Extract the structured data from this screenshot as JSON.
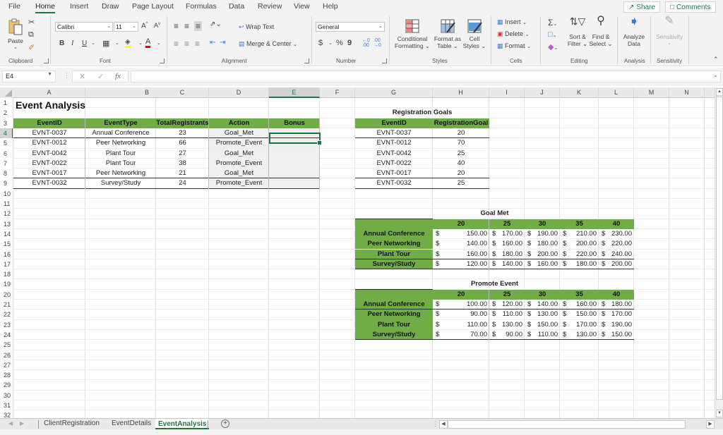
{
  "menu": {
    "tabs": [
      "File",
      "Home",
      "Insert",
      "Draw",
      "Page Layout",
      "Formulas",
      "Data",
      "Review",
      "View",
      "Help"
    ],
    "active_tab": "Home",
    "share_label": "Share",
    "comments_label": "Comments"
  },
  "ribbon": {
    "clipboard": {
      "label": "Clipboard",
      "paste": "Paste"
    },
    "font": {
      "label": "Font",
      "font_name": "Calibri",
      "font_size": "11",
      "bold": "B",
      "italic": "I",
      "underline": "U"
    },
    "alignment": {
      "label": "Alignment",
      "wrap_text": "Wrap Text",
      "merge_center": "Merge & Center"
    },
    "number": {
      "label": "Number",
      "format": "General",
      "currency": "$",
      "percent": "%",
      "comma": "9"
    },
    "styles": {
      "label": "Styles",
      "conditional_formatting": [
        "Conditional",
        "Formatting"
      ],
      "format_as_table": [
        "Format as",
        "Table"
      ],
      "cell_styles": [
        "Cell",
        "Styles"
      ]
    },
    "cells": {
      "label": "Cells",
      "insert": "Insert",
      "delete": "Delete",
      "format": "Format"
    },
    "editing": {
      "label": "Editing",
      "sort_filter": [
        "Sort &",
        "Filter"
      ],
      "find_select": [
        "Find &",
        "Select"
      ]
    },
    "analysis": {
      "label": "Analysis",
      "analyze_data": [
        "Analyze",
        "Data"
      ]
    },
    "sensitivity": {
      "label": "Sensitivity",
      "button": "Sensitivity"
    }
  },
  "formula_bar": {
    "name_box": "E4",
    "formula": ""
  },
  "columns": [
    "A",
    "B",
    "C",
    "D",
    "E",
    "F",
    "G",
    "H",
    "I",
    "J",
    "K",
    "L",
    "M",
    "N"
  ],
  "selected_column": "E",
  "selected_row": 4,
  "rows": [
    1,
    2,
    3,
    4,
    5,
    6,
    7,
    8,
    9,
    10,
    11,
    12,
    13,
    14,
    15,
    16,
    17,
    18,
    19,
    20,
    21,
    22,
    23,
    24,
    25,
    26,
    27,
    28,
    29,
    30,
    31,
    32
  ],
  "sheet": {
    "title": "Event Analysis",
    "main_table": {
      "headers": [
        "EventID",
        "EventType",
        "TotalRegistrants",
        "Action",
        "Bonus"
      ],
      "rows": [
        [
          "EVNT-0037",
          "Annual Conference",
          "23",
          "Goal_Met",
          ""
        ],
        [
          "EVNT-0012",
          "Peer Networking",
          "66",
          "Promote_Event",
          ""
        ],
        [
          "EVNT-0042",
          "Plant Tour",
          "27",
          "Goal_Met",
          ""
        ],
        [
          "EVNT-0022",
          "Plant Tour",
          "38",
          "Promote_Event",
          ""
        ],
        [
          "EVNT-0017",
          "Peer Networking",
          "21",
          "Goal_Met",
          ""
        ],
        [
          "EVNT-0032",
          "Survey/Study",
          "24",
          "Promote_Event",
          ""
        ]
      ]
    },
    "goals_table": {
      "title": "Registration Goals",
      "headers": [
        "EventID",
        "RegistrationGoal"
      ],
      "rows": [
        [
          "EVNT-0037",
          "20"
        ],
        [
          "EVNT-0012",
          "70"
        ],
        [
          "EVNT-0042",
          "25"
        ],
        [
          "EVNT-0022",
          "40"
        ],
        [
          "EVNT-0017",
          "20"
        ],
        [
          "EVNT-0032",
          "25"
        ]
      ]
    },
    "goal_met_table": {
      "title": "Goal Met",
      "thresholds": [
        "20",
        "25",
        "30",
        "35",
        "40"
      ],
      "rows": [
        {
          "type": "Annual Conference",
          "values": [
            "150.00",
            "170.00",
            "190.00",
            "210.00",
            "230.00"
          ]
        },
        {
          "type": "Peer Networking",
          "values": [
            "140.00",
            "160.00",
            "180.00",
            "200.00",
            "220.00"
          ]
        },
        {
          "type": "Plant Tour",
          "values": [
            "160.00",
            "180.00",
            "200.00",
            "220.00",
            "240.00"
          ]
        },
        {
          "type": "Survey/Study",
          "values": [
            "120.00",
            "140.00",
            "160.00",
            "180.00",
            "200.00"
          ]
        }
      ]
    },
    "promote_table": {
      "title": "Promote Event",
      "thresholds": [
        "20",
        "25",
        "30",
        "35",
        "40"
      ],
      "rows": [
        {
          "type": "Annual Conference",
          "values": [
            "100.00",
            "120.00",
            "140.00",
            "160.00",
            "180.00"
          ]
        },
        {
          "type": "Peer Networking",
          "values": [
            "90.00",
            "110.00",
            "130.00",
            "150.00",
            "170.00"
          ]
        },
        {
          "type": "Plant Tour",
          "values": [
            "110.00",
            "130.00",
            "150.00",
            "170.00",
            "190.00"
          ]
        },
        {
          "type": "Survey/Study",
          "values": [
            "70.00",
            "90.00",
            "110.00",
            "130.00",
            "150.00"
          ]
        }
      ]
    },
    "currency_symbol": "$"
  },
  "sheet_tabs": [
    "ClientRegistration",
    "EventDetails",
    "EventAnalysis"
  ],
  "active_sheet": "EventAnalysis",
  "colors": {
    "header_green": "#70ad47",
    "excel_green": "#217346"
  }
}
